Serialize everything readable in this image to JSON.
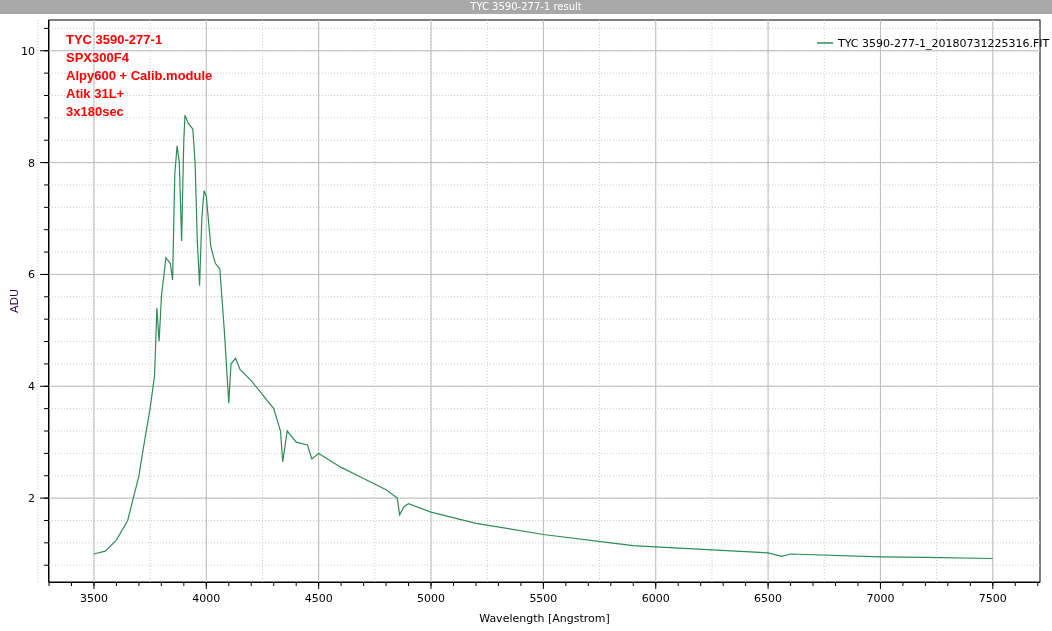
{
  "window": {
    "title": "TYC 3590-277-1 result"
  },
  "plot": {
    "chart_data": {
      "type": "line",
      "grid": true,
      "xlabel": "Wavelength [Angstrom]",
      "ylabel": "ADU",
      "xlim": [
        3300,
        7710
      ],
      "ylim": [
        0.5,
        10.55
      ],
      "xticks": [
        3500,
        4000,
        4500,
        5000,
        5500,
        6000,
        6500,
        7000,
        7500
      ],
      "yticks": [
        2,
        4,
        6,
        8,
        10
      ],
      "x": [
        3500,
        3550,
        3600,
        3650,
        3700,
        3720,
        3750,
        3770,
        3780,
        3790,
        3800,
        3820,
        3840,
        3850,
        3860,
        3870,
        3880,
        3890,
        3900,
        3905,
        3920,
        3940,
        3950,
        3960,
        3970,
        3980,
        3990,
        4000,
        4020,
        4040,
        4060,
        4080,
        4100,
        4110,
        4130,
        4150,
        4200,
        4250,
        4300,
        4330,
        4340,
        4360,
        4400,
        4450,
        4470,
        4500,
        4600,
        4700,
        4800,
        4850,
        4860,
        4880,
        4900,
        5000,
        5200,
        5500,
        5800,
        5900,
        6000,
        6500,
        6560,
        6600,
        7000,
        7200,
        7500
      ],
      "series": [
        {
          "name": "TYC 3590-277-1_20180731225316.FIT",
          "color": "#2e8b57",
          "values": [
            1.0,
            1.05,
            1.25,
            1.6,
            2.4,
            2.9,
            3.6,
            4.2,
            5.4,
            4.8,
            5.6,
            6.3,
            6.2,
            5.9,
            7.8,
            8.3,
            8.0,
            6.6,
            8.4,
            8.85,
            8.7,
            8.6,
            8.0,
            6.6,
            5.8,
            7.0,
            7.5,
            7.4,
            6.5,
            6.2,
            6.1,
            5.0,
            3.7,
            4.4,
            4.5,
            4.3,
            4.1,
            3.85,
            3.6,
            3.2,
            2.65,
            3.2,
            3.0,
            2.95,
            2.7,
            2.8,
            2.55,
            2.35,
            2.15,
            2.0,
            1.7,
            1.85,
            1.9,
            1.75,
            1.55,
            1.35,
            1.2,
            1.15,
            1.13,
            1.02,
            0.96,
            1.0,
            0.95,
            0.94,
            0.92
          ]
        }
      ],
      "annotations": [
        "TYC 3590-277-1",
        "SPX300F4",
        "Alpy600 + Calib.module",
        "Atik 31L+",
        "3x180sec"
      ]
    }
  }
}
